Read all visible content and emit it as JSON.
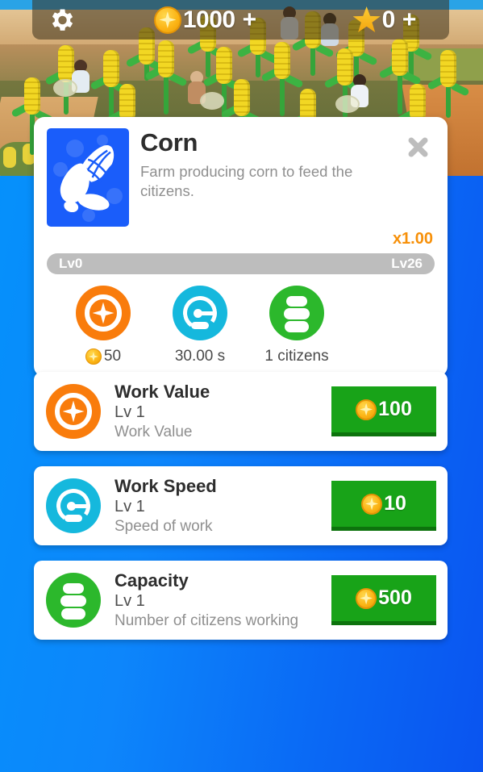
{
  "topbar": {
    "settings_icon": "gear-icon",
    "coin": {
      "icon": "coin-icon",
      "value": "1000",
      "plus": "+"
    },
    "star": {
      "icon": "star-icon",
      "value": "0",
      "plus": "+"
    }
  },
  "detail_card": {
    "thumbnail_icon": "corn-icon",
    "title": "Corn",
    "description": "Farm producing corn to feed the citizens.",
    "close_icon": "close-icon",
    "multiplier": "x1.00",
    "level_bar": {
      "min_label": "Lv0",
      "max_label": "Lv26",
      "progress_percent": 0
    },
    "stats": [
      {
        "icon": "work-value-icon",
        "color": "#f97c0c",
        "value": "50",
        "has_coin": true
      },
      {
        "icon": "work-speed-icon",
        "color": "#15b8dd",
        "value": "30.00 s",
        "has_coin": false
      },
      {
        "icon": "capacity-icon",
        "color": "#2cb82c",
        "value": "1 citizens",
        "has_coin": false
      }
    ]
  },
  "upgrades": [
    {
      "icon": "work-value-icon",
      "title": "Work Value",
      "level": "Lv 1",
      "description": "Work Value",
      "button": {
        "icon": "coin-icon",
        "price": "100",
        "color": "#18a318"
      }
    },
    {
      "icon": "work-speed-icon",
      "title": "Work Speed",
      "level": "Lv 1",
      "description": "Speed of work",
      "button": {
        "icon": "coin-icon",
        "price": "10",
        "color": "#18a318"
      }
    },
    {
      "icon": "capacity-icon",
      "title": "Capacity",
      "level": "Lv 1",
      "description": "Number of citizens working",
      "button": {
        "icon": "coin-icon",
        "price": "500",
        "color": "#18a318"
      }
    }
  ],
  "theme": {
    "background_start": "#0492fb",
    "background_end": "#0a54f0",
    "accent_orange": "#f79009",
    "accent_green": "#18a318",
    "accent_cyan": "#15b8dd"
  }
}
